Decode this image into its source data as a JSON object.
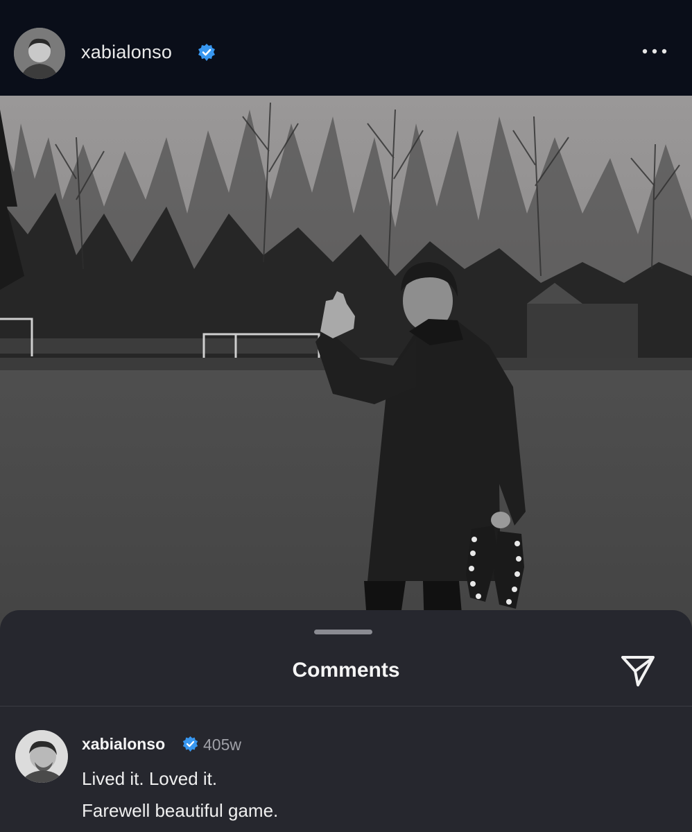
{
  "post": {
    "username": "xabialonso",
    "verified_icon": "verified-badge-icon",
    "more_icon": "more-options-icon"
  },
  "sheet": {
    "title": "Comments",
    "share_icon": "send-icon"
  },
  "comment": {
    "username": "xabialonso",
    "age": "405w",
    "line1": "Lived it. Loved it.",
    "line2": "Farewell beautiful game."
  },
  "colors": {
    "verified": "#3897f0",
    "sheet_bg": "#26272e",
    "header_bg": "#0a0e19"
  }
}
